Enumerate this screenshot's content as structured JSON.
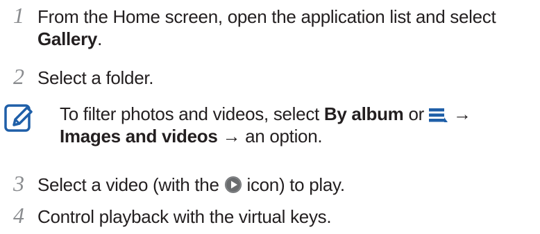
{
  "steps": [
    {
      "number": "1",
      "text_before": "From the Home screen, open the application list and select ",
      "bold": "Gallery",
      "text_after": "."
    },
    {
      "number": "2",
      "text": "Select a folder."
    },
    {
      "number": "3",
      "text_before": "Select a video (with the ",
      "icon": "play-icon",
      "text_after": " icon) to play."
    },
    {
      "number": "4",
      "text": "Control playback with the virtual keys."
    }
  ],
  "note": {
    "icon": "note-pencil-icon",
    "part1": "To filter photos and videos, select ",
    "bold1": "By album",
    "part2": " or ",
    "menu_icon": "menu-icon",
    "arrow1": " →",
    "bold2": "Images and videos",
    "part3": " → an option."
  },
  "colors": {
    "text": "#231f20",
    "step_number": "#8a8c8f",
    "note_icon": "#1f5fa8",
    "menu_icon": "#1f5fa8",
    "play_icon": "#6a6c6e"
  }
}
